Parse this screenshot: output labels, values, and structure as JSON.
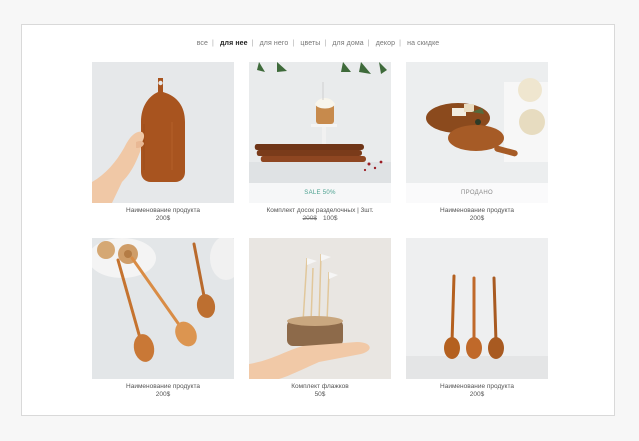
{
  "nav": {
    "items": [
      "все",
      "для нее",
      "для него",
      "цветы",
      "для дома",
      "декор",
      "на скидке"
    ],
    "active_index": 1
  },
  "products": [
    {
      "name": "Наименование продукта",
      "price": "200$"
    },
    {
      "name": "Комплект досок разделочных | 3шт.",
      "old_price": "200$",
      "price": "100$",
      "badge": "SALE 50%"
    },
    {
      "name": "Наименование продукта",
      "price": "200$",
      "badge": "ПРОДАНО"
    },
    {
      "name": "Наименование продукта",
      "price": "200$"
    },
    {
      "name": "Комплект флажков",
      "price": "50$"
    },
    {
      "name": "Наименование продукта",
      "price": "200$"
    }
  ],
  "colors": {
    "sale": "#49a08e",
    "sold": "#8a8a8a",
    "wood": "#a8541f"
  }
}
